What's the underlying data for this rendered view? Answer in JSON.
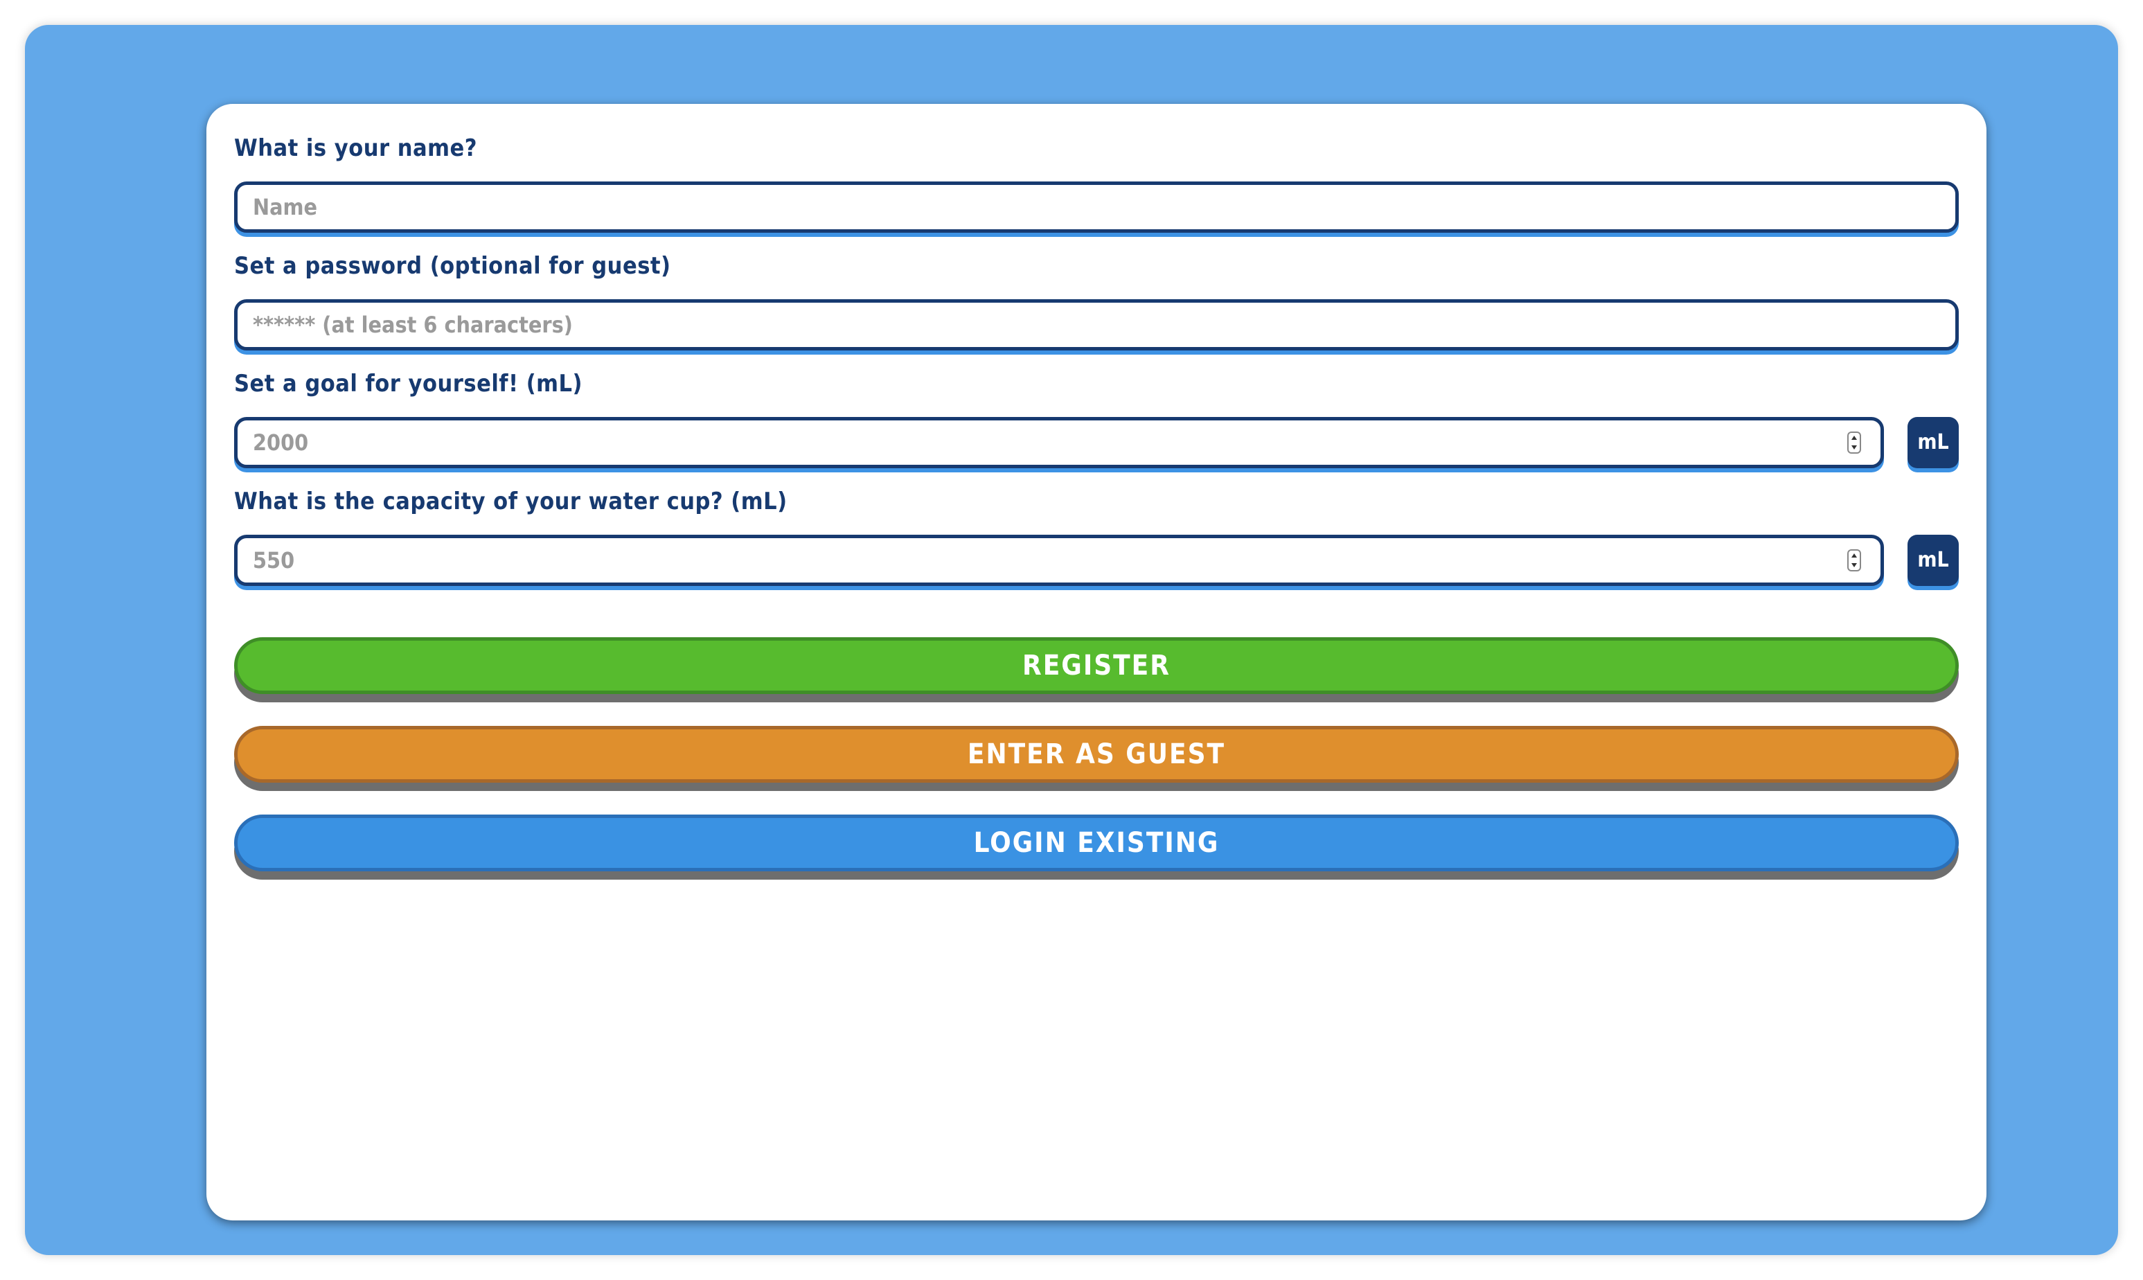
{
  "form": {
    "name_label": "What is your name?",
    "name_placeholder": "Name",
    "password_label": "Set a password (optional for guest)",
    "password_placeholder": "****** (at least 6 characters)",
    "goal_label": "Set a goal for yourself! (mL)",
    "goal_value": "2000",
    "goal_unit": "mL",
    "cup_label": "What is the capacity of your water cup? (mL)",
    "cup_value": "550",
    "cup_unit": "mL"
  },
  "buttons": {
    "register": "REGISTER",
    "guest": "ENTER AS GUEST",
    "login": "LOGIN EXISTING"
  },
  "colors": {
    "background": "#62a8e9",
    "label_text": "#173a70",
    "register": "#57bb2e",
    "guest": "#df8f2d",
    "login": "#3a92e3"
  }
}
